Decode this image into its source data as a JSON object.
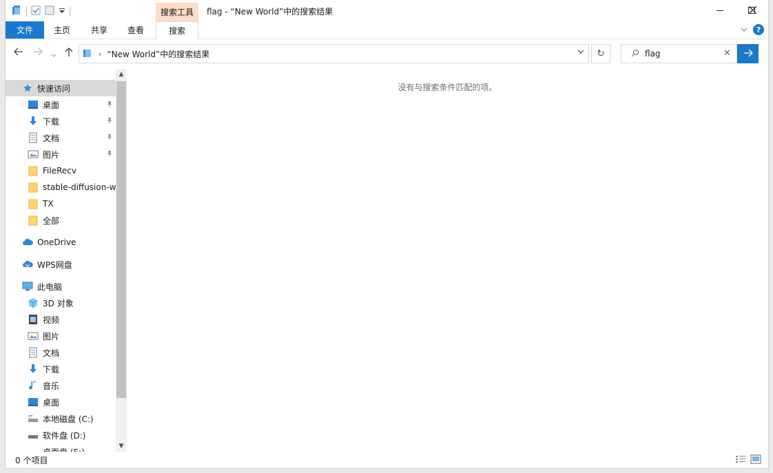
{
  "titlebar": {
    "context_tab": "搜索工具",
    "title": "flag - “New World”中的搜索结果"
  },
  "ribbon": {
    "tabs": [
      "文件",
      "主页",
      "共享",
      "查看",
      "搜索"
    ]
  },
  "address": {
    "path": "“New World”中的搜索结果"
  },
  "search": {
    "value": "flag"
  },
  "sidebar": {
    "items": [
      {
        "label": "快速访问",
        "icon": "star-icon"
      },
      {
        "label": "桌面",
        "icon": "desktop-icon",
        "pinned": true
      },
      {
        "label": "下载",
        "icon": "download-icon",
        "pinned": true
      },
      {
        "label": "文档",
        "icon": "document-icon",
        "pinned": true
      },
      {
        "label": "图片",
        "icon": "pictures-icon",
        "pinned": true
      },
      {
        "label": "FileRecv",
        "icon": "folder-icon"
      },
      {
        "label": "stable-diffusion-we",
        "icon": "folder-icon"
      },
      {
        "label": "TX",
        "icon": "folder-icon"
      },
      {
        "label": "全部",
        "icon": "folder-icon"
      },
      {
        "label": "OneDrive",
        "icon": "cloud-icon"
      },
      {
        "label": "WPS网盘",
        "icon": "wps-cloud-icon"
      },
      {
        "label": "此电脑",
        "icon": "computer-icon"
      },
      {
        "label": "3D 对象",
        "icon": "3d-objects-icon"
      },
      {
        "label": "视频",
        "icon": "video-icon"
      },
      {
        "label": "图片",
        "icon": "pictures-icon"
      },
      {
        "label": "文档",
        "icon": "document-icon"
      },
      {
        "label": "下载",
        "icon": "download-icon"
      },
      {
        "label": "音乐",
        "icon": "music-icon"
      },
      {
        "label": "桌面",
        "icon": "desktop-icon"
      },
      {
        "label": "本地磁盘 (C:)",
        "icon": "drive-c-icon"
      },
      {
        "label": "软件盘 (D:)",
        "icon": "drive-icon"
      },
      {
        "label": "桌面盘 (E:)",
        "icon": "drive-icon"
      }
    ]
  },
  "content": {
    "empty_message": "没有与搜索条件匹配的项。"
  },
  "status": {
    "item_count": "0 个项目"
  },
  "colors": {
    "accent": "#1979ca",
    "context_tab": "#fbdcc7",
    "selection": "#d9d9d9"
  }
}
